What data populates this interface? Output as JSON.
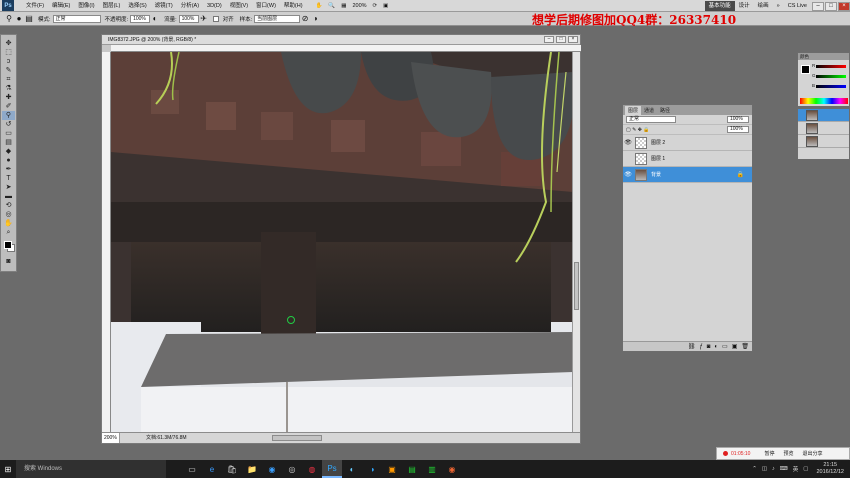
{
  "menubar": {
    "logo": "Ps",
    "items": [
      "文件(F)",
      "编辑(E)",
      "图像(I)",
      "图层(L)",
      "选择(S)",
      "滤镜(T)",
      "分析(A)",
      "3D(D)",
      "视图(V)",
      "窗口(W)",
      "帮助(H)"
    ],
    "zoom": "200%",
    "workspaces": [
      "基本功能",
      "设计",
      "绘画"
    ],
    "more": "»",
    "cslive": "CS Live"
  },
  "options": {
    "mode_label": "模式:",
    "mode_value": "正常",
    "opacity_label": "不透明度:",
    "opacity_value": "100%",
    "flow_label": "流量:",
    "flow_value": "100%",
    "align_label": "对齐",
    "sample_label": "样本:",
    "sample_value": "当前图层"
  },
  "banner": "想学后期修图加QQ4群：26337410",
  "document": {
    "title": "IMG8372.JPG @ 200% (背景, RGB/8) *",
    "zoom": "200%",
    "info": "文档:61.3M/76.8M"
  },
  "layers": {
    "tabs": [
      "图层",
      "通道",
      "路径"
    ],
    "blend_mode": "正常",
    "opacity_value": "100%",
    "fill_value": "100%",
    "items": [
      {
        "name": "图层 2",
        "selected": false,
        "visible": true
      },
      {
        "name": "图层 1",
        "selected": false,
        "visible": false
      },
      {
        "name": "背景",
        "selected": true,
        "visible": true
      }
    ]
  },
  "color_panel": {
    "tabs": "颜色",
    "channels": [
      "R",
      "G",
      "B"
    ]
  },
  "recorder": {
    "time": "01:05:10",
    "pause": "暂停",
    "preview": "预览",
    "exit": "退出分享"
  },
  "taskbar": {
    "search": "搜索 Windows",
    "lang": "英",
    "time": "21:15",
    "date": "2016/12/12"
  },
  "colors": {
    "selection": "#3f8fd8",
    "banner": "#e00000"
  }
}
